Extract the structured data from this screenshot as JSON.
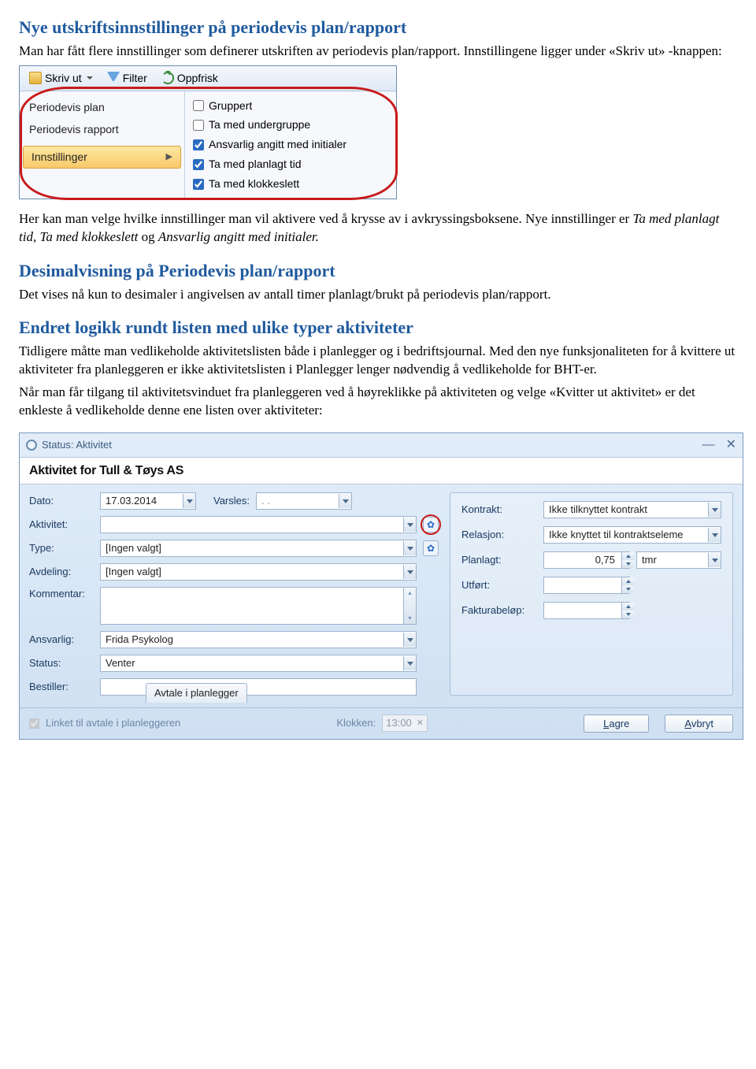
{
  "section1": {
    "title": "Nye utskriftsinnstillinger på periodevis plan/rapport",
    "p1": "Man har fått flere innstillinger som definerer utskriften av periodevis plan/rapport. Innstillingene ligger under «Skriv ut» -knappen:",
    "p2a": "Her kan man velge hvilke innstillinger man vil aktivere ved å krysse av i avkryssingsboksene. Nye innstillinger er ",
    "p2_i1": "Ta med planlagt tid, Ta med klokkeslett",
    "p2_mid": " og ",
    "p2_i2": "Ansvarlig angitt med initialer."
  },
  "menu": {
    "skrivut": "Skriv ut",
    "filter": "Filter",
    "oppfrisk": "Oppfrisk",
    "items": {
      "plan": "Periodevis plan",
      "rapport": "Periodevis rapport",
      "innstillinger": "Innstillinger"
    },
    "checks": {
      "gruppert": "Gruppert",
      "undergruppe": "Ta med undergruppe",
      "initialer": "Ansvarlig angitt med initialer",
      "planlagt": "Ta med planlagt tid",
      "klokkeslett": "Ta med klokkeslett"
    }
  },
  "section2": {
    "title": "Desimalvisning på Periodevis plan/rapport",
    "p1": "Det vises nå kun to desimaler i angivelsen av antall timer planlagt/brukt på periodevis plan/rapport."
  },
  "section3": {
    "title": "Endret logikk rundt listen med ulike typer aktiviteter",
    "p1": "Tidligere måtte man vedlikeholde aktivitetslisten både i planlegger og i bedriftsjournal. Med den nye funksjonaliteten for å kvittere ut aktiviteter fra planleggeren er ikke aktivitetslisten i Planlegger lenger nødvendig å vedlikeholde for BHT-er.",
    "p2": "Når man får tilgang til aktivitetsvinduet fra planleggeren ved å høyreklikke på aktiviteten og velge «Kvitter ut aktivitet» er det enkleste å vedlikeholde denne ene listen over aktiviteter:"
  },
  "dlg": {
    "status": "Status: Aktivitet",
    "head": "Aktivitet for Tull & Tøys AS",
    "labels": {
      "dato": "Dato:",
      "varsles": "Varsles:",
      "aktivitet": "Aktivitet:",
      "type": "Type:",
      "avdeling": "Avdeling:",
      "kommentar": "Kommentar:",
      "ansvarlig": "Ansvarlig:",
      "status_l": "Status:",
      "bestiller": "Bestiller:",
      "kontrakt": "Kontrakt:",
      "relasjon": "Relasjon:",
      "planlagt": "Planlagt:",
      "utfort": "Utført:",
      "faktura": "Fakturabeløp:"
    },
    "values": {
      "dato": "17.03.2014",
      "varsles": ".  .",
      "type": "[Ingen valgt]",
      "avdeling": "[Ingen valgt]",
      "ansvarlig": "Frida Psykolog",
      "status": "Venter",
      "kontrakt": "Ikke tilknyttet kontrakt",
      "relasjon": "Ikke knyttet til kontraktseleme",
      "planlagt": "0,75",
      "tmr": "tmr"
    },
    "tab": "Avtale i planlegger",
    "linket": "Linket til avtale i planleggeren",
    "klokken": "Klokken:",
    "klokken_v": "13:00",
    "lagre": "Lagre",
    "avbryt": "Avbryt"
  }
}
